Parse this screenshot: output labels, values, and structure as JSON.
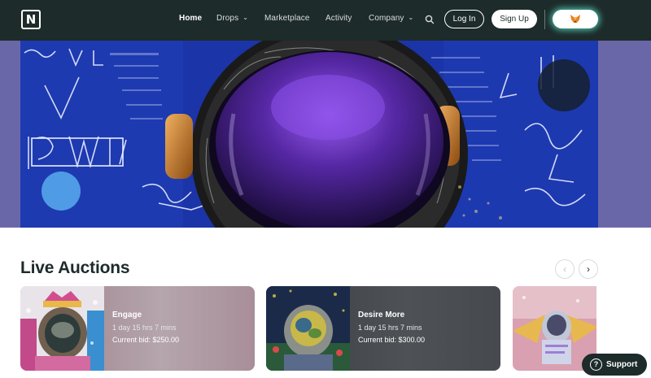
{
  "nav": {
    "logo": "N",
    "items": [
      {
        "label": "Home",
        "active": true
      },
      {
        "label": "Drops",
        "dropdown": true
      },
      {
        "label": "Marketplace"
      },
      {
        "label": "Activity"
      },
      {
        "label": "Company",
        "dropdown": true
      }
    ],
    "login_label": "Log In",
    "signup_label": "Sign Up",
    "wallet_icon": "fox-icon"
  },
  "hero": {
    "image": "astronaut-helmet-wonder-artwork"
  },
  "auctions": {
    "title": "Live Auctions",
    "prev_icon": "chevron-left-icon",
    "next_icon": "chevron-right-icon",
    "cards": [
      {
        "title": "Engage",
        "time_left": "1 day 15 hrs 7 mins",
        "bid": "Current bid: $250.00"
      },
      {
        "title": "Desire More",
        "time_left": "1 day 15 hrs 7 mins",
        "bid": "Current bid: $300.00"
      },
      {
        "title": "",
        "time_left": "",
        "bid": ""
      }
    ]
  },
  "support": {
    "label": "Support",
    "icon": "question-icon"
  },
  "colors": {
    "nav_bg": "#1d2b2a",
    "hero_bg": "#6a67a8",
    "accent_glow": "#60f0d7"
  }
}
